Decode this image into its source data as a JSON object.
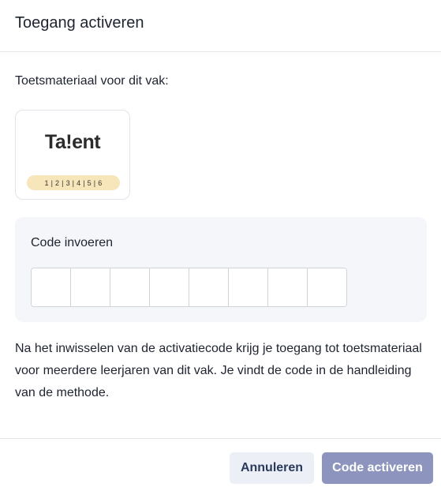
{
  "dialog": {
    "title": "Toegang activeren"
  },
  "material": {
    "label": "Toetsmateriaal voor dit vak:",
    "product": {
      "logo_text": "Ta!ent",
      "grades": "1 | 2 | 3 | 4 | 5 | 6"
    }
  },
  "code_entry": {
    "label": "Code invoeren",
    "values": [
      "",
      "",
      "",
      "",
      "",
      "",
      "",
      ""
    ]
  },
  "description": "Na het inwisselen van de activatiecode krijg je toegang tot toetsmateriaal voor meerdere leerjaren van dit vak. Je vindt de code in de handleiding van de methode.",
  "footer": {
    "cancel_label": "Annuleren",
    "activate_label": "Code activeren"
  },
  "colors": {
    "primary_button": "#8d95bf",
    "secondary_button": "#ecf0f6",
    "grade_pill": "#f7e6b9"
  }
}
